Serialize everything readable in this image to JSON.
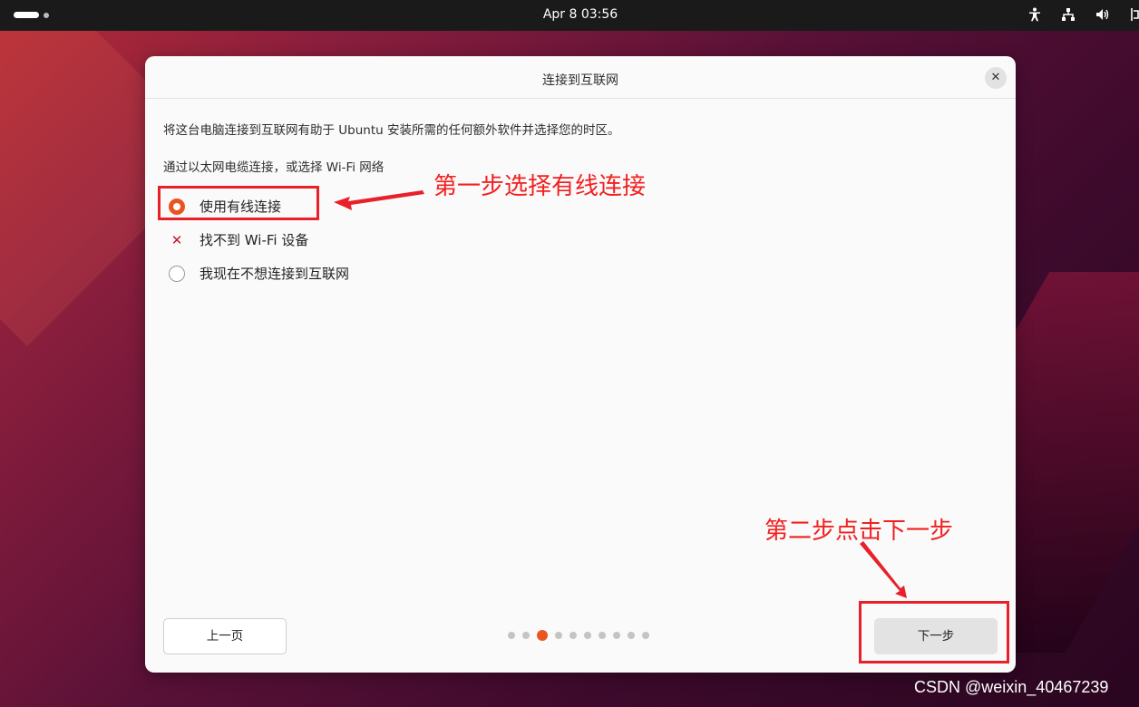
{
  "topbar": {
    "clock": "Apr 8  03:56",
    "icons": [
      "accessibility-icon",
      "network-wired-icon",
      "volume-icon",
      "battery-icon"
    ]
  },
  "dialog": {
    "title": "连接到互联网",
    "close_label": "✕",
    "intro": "将这台电脑连接到互联网有助于 Ubuntu 安装所需的任何额外软件并选择您的时区。",
    "subtitle": "通过以太网电缆连接，或选择 Wi-Fi 网络",
    "options": [
      {
        "label": "使用有线连接",
        "state": "selected"
      },
      {
        "label": "找不到 Wi-Fi 设备",
        "state": "unavailable"
      },
      {
        "label": "我现在不想连接到互联网",
        "state": "unselected"
      }
    ],
    "back_label": "上一页",
    "next_label": "下一步",
    "pager": {
      "total": 10,
      "current": 3
    }
  },
  "annotations": {
    "step1": "第一步选择有线连接",
    "step2": "第二步点击下一步"
  },
  "watermark": "CSDN @weixin_40467239",
  "colors": {
    "accent": "#e95420",
    "annotation": "#f22020"
  }
}
